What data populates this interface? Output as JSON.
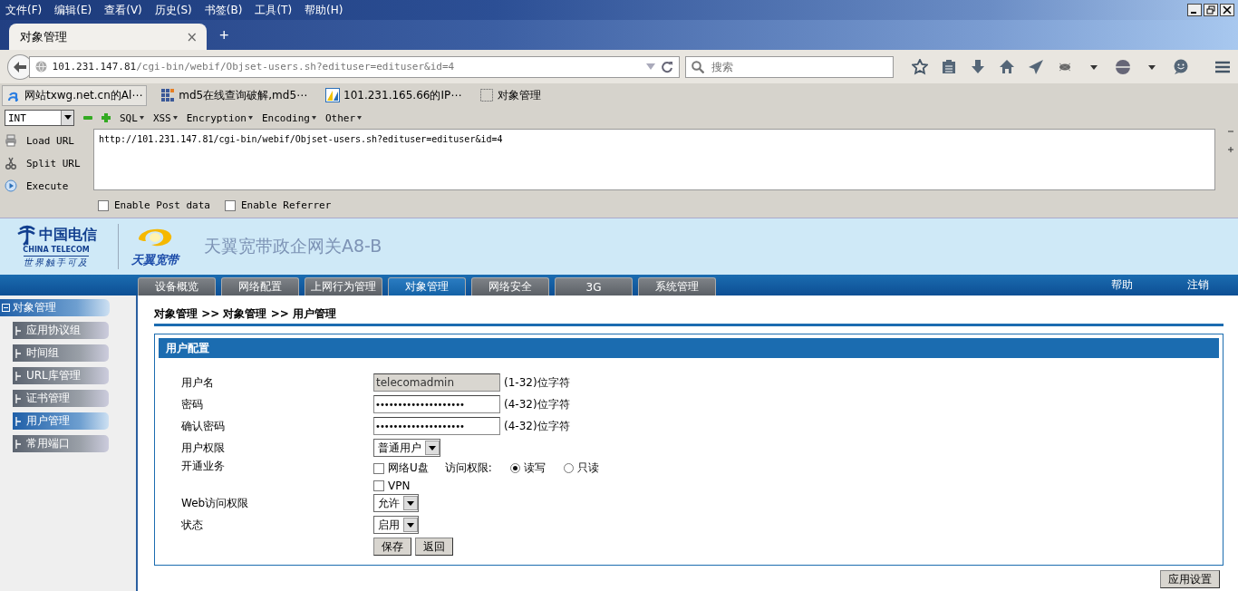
{
  "browser": {
    "menu": [
      "文件(F)",
      "编辑(E)",
      "查看(V)",
      "历史(S)",
      "书签(B)",
      "工具(T)",
      "帮助(H)"
    ],
    "tab": {
      "title": "对象管理",
      "close": "×",
      "new_tab": "+"
    },
    "address": {
      "host": "101.231.147.81",
      "path": "/cgi-bin/webif/Objset-users.sh?edituser=edituser&id=4"
    },
    "search": {
      "placeholder": "搜索"
    },
    "bookmarks": [
      {
        "label": "网站txwg.net.cn的Al⋯",
        "kind": "a"
      },
      {
        "label": "md5在线查询破解,md5⋯",
        "kind": "grid"
      },
      {
        "label": "101.231.165.66的IP⋯",
        "kind": "chart"
      },
      {
        "label": "对象管理",
        "kind": "blank"
      }
    ]
  },
  "hackbar": {
    "select": "INT",
    "menus": [
      "SQL",
      "XSS",
      "Encryption",
      "Encoding",
      "Other"
    ],
    "actions": [
      {
        "label": "Load URL",
        "kind": "load"
      },
      {
        "label": "Split URL",
        "kind": "split"
      },
      {
        "label": "Execute",
        "kind": "execute"
      }
    ],
    "url": "http://101.231.147.81/cgi-bin/webif/Objset-users.sh?edituser=edituser&id=4",
    "options": [
      {
        "label": "Enable Post data",
        "checked": false
      },
      {
        "label": "Enable Referrer",
        "checked": false
      }
    ]
  },
  "header": {
    "logo_cn": "中国电信",
    "logo_en": "CHINA TELECOM",
    "slogan": "世界触手可及",
    "brand": "天翼宽带",
    "title": "天翼宽带政企网关A8-B"
  },
  "nav": [
    {
      "label": "设备概览",
      "selected": false
    },
    {
      "label": "网络配置",
      "selected": false
    },
    {
      "label": "上网行为管理",
      "selected": false
    },
    {
      "label": "对象管理",
      "selected": true
    },
    {
      "label": "网络安全",
      "selected": false
    },
    {
      "label": "3G",
      "selected": false
    },
    {
      "label": "系统管理",
      "selected": false
    }
  ],
  "nav_links": [
    "帮助",
    "注销"
  ],
  "sidebar": {
    "group": {
      "label": "对象管理",
      "expanded": true
    },
    "items": [
      {
        "label": "应用协议组",
        "selected": false
      },
      {
        "label": "时间组",
        "selected": false
      },
      {
        "label": "URL库管理",
        "selected": false
      },
      {
        "label": "证书管理",
        "selected": false
      },
      {
        "label": "用户管理",
        "selected": true
      },
      {
        "label": "常用端口",
        "selected": false
      }
    ]
  },
  "breadcrumb": "对象管理 >> 对象管理 >> 用户管理",
  "panel": {
    "title": "用户配置",
    "rows": [
      {
        "kind": "readonly",
        "label": "用户名",
        "value": "telecomadmin",
        "hint": "(1-32)位字符"
      },
      {
        "kind": "text",
        "label": "密码",
        "value": "••••••••••••••••••••",
        "hint": "(4-32)位字符"
      },
      {
        "kind": "text",
        "label": "确认密码",
        "value": "••••••••••••••••••••",
        "hint": "(4-32)位字符"
      },
      {
        "kind": "select",
        "label": "用户权限",
        "value": "普通用户"
      },
      {
        "kind": "services",
        "label": "开通业务",
        "services": [
          {
            "label": "网络U盘",
            "checked": false,
            "access_label": "访问权限:",
            "access": [
              {
                "label": "读写",
                "selected": true
              },
              {
                "label": "只读",
                "selected": false
              }
            ]
          },
          {
            "label": "VPN",
            "checked": false
          }
        ]
      },
      {
        "kind": "select",
        "label": "Web访问权限",
        "value": "允许"
      },
      {
        "kind": "select",
        "label": "状态",
        "value": "启用"
      },
      {
        "kind": "buttons",
        "buttons": [
          "保存",
          "返回"
        ]
      }
    ]
  },
  "apply_button": "应用设置"
}
